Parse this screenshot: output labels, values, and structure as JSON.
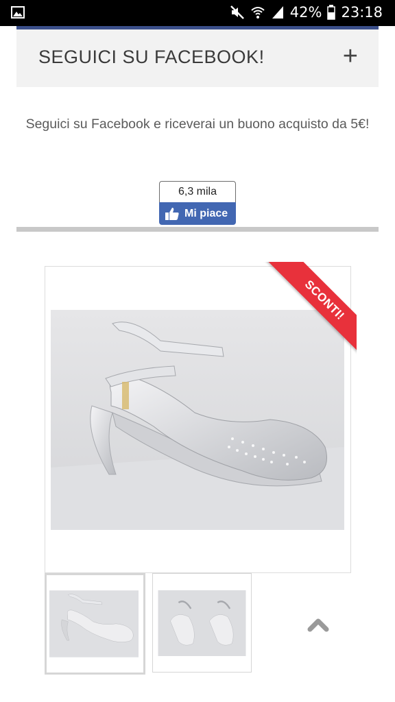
{
  "status_bar": {
    "battery_percent": "42%",
    "time": "23:18",
    "icons": [
      "gallery-icon",
      "mute-icon",
      "wifi-icon",
      "signal-icon",
      "battery-icon"
    ]
  },
  "accordion": {
    "title": "SEGUICI SU FACEBOOK!",
    "toggle": "+"
  },
  "promo": {
    "text": "Seguici su Facebook e riceverai un buono acquisto da 5€!"
  },
  "facebook_like": {
    "count": "6,3 mila",
    "button_label": "Mi piace",
    "color": "#4267b2"
  },
  "product": {
    "badge": "SCONTI!",
    "badge_color": "#e8313b",
    "thumbnails": [
      "shoe-side-view",
      "shoe-pair-view"
    ]
  },
  "scroll_top": {
    "icon": "chevron-up-icon"
  }
}
